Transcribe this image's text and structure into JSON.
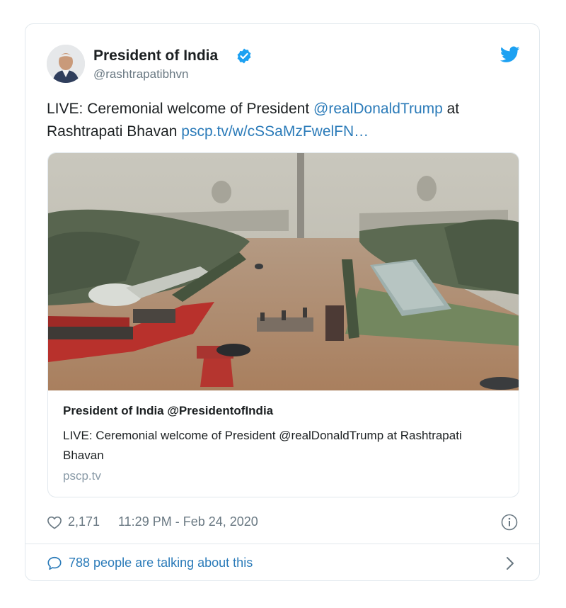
{
  "author": {
    "name": "President of India",
    "handle": "@rashtrapatibhvn"
  },
  "tweet": {
    "text_prefix": "LIVE: Ceremonial welcome of President ",
    "mention": "@realDonaldTrump",
    "text_mid": " at Rashtrapati Bhavan ",
    "link": "pscp.tv/w/cSSaMzFwelFN…"
  },
  "card": {
    "title": "President of India @PresidentofIndia",
    "description": "LIVE: Ceremonial welcome of President @realDonaldTrump at Rashtrapati Bhavan",
    "domain": "pscp.tv"
  },
  "meta": {
    "likes": "2,171",
    "timestamp": "11:29 PM - Feb 24, 2020"
  },
  "footer": {
    "talking": "788 people are talking about this"
  },
  "icons": {
    "verified": "verified-badge-icon",
    "brand": "twitter-bird-icon",
    "like": "heart-icon",
    "info": "info-icon",
    "reply": "speech-bubble-icon",
    "more": "chevron-right-icon"
  },
  "colors": {
    "link": "#2b7bb9",
    "verified": "#1da1f2",
    "muted": "#697882",
    "border": "#e1e8ed"
  }
}
